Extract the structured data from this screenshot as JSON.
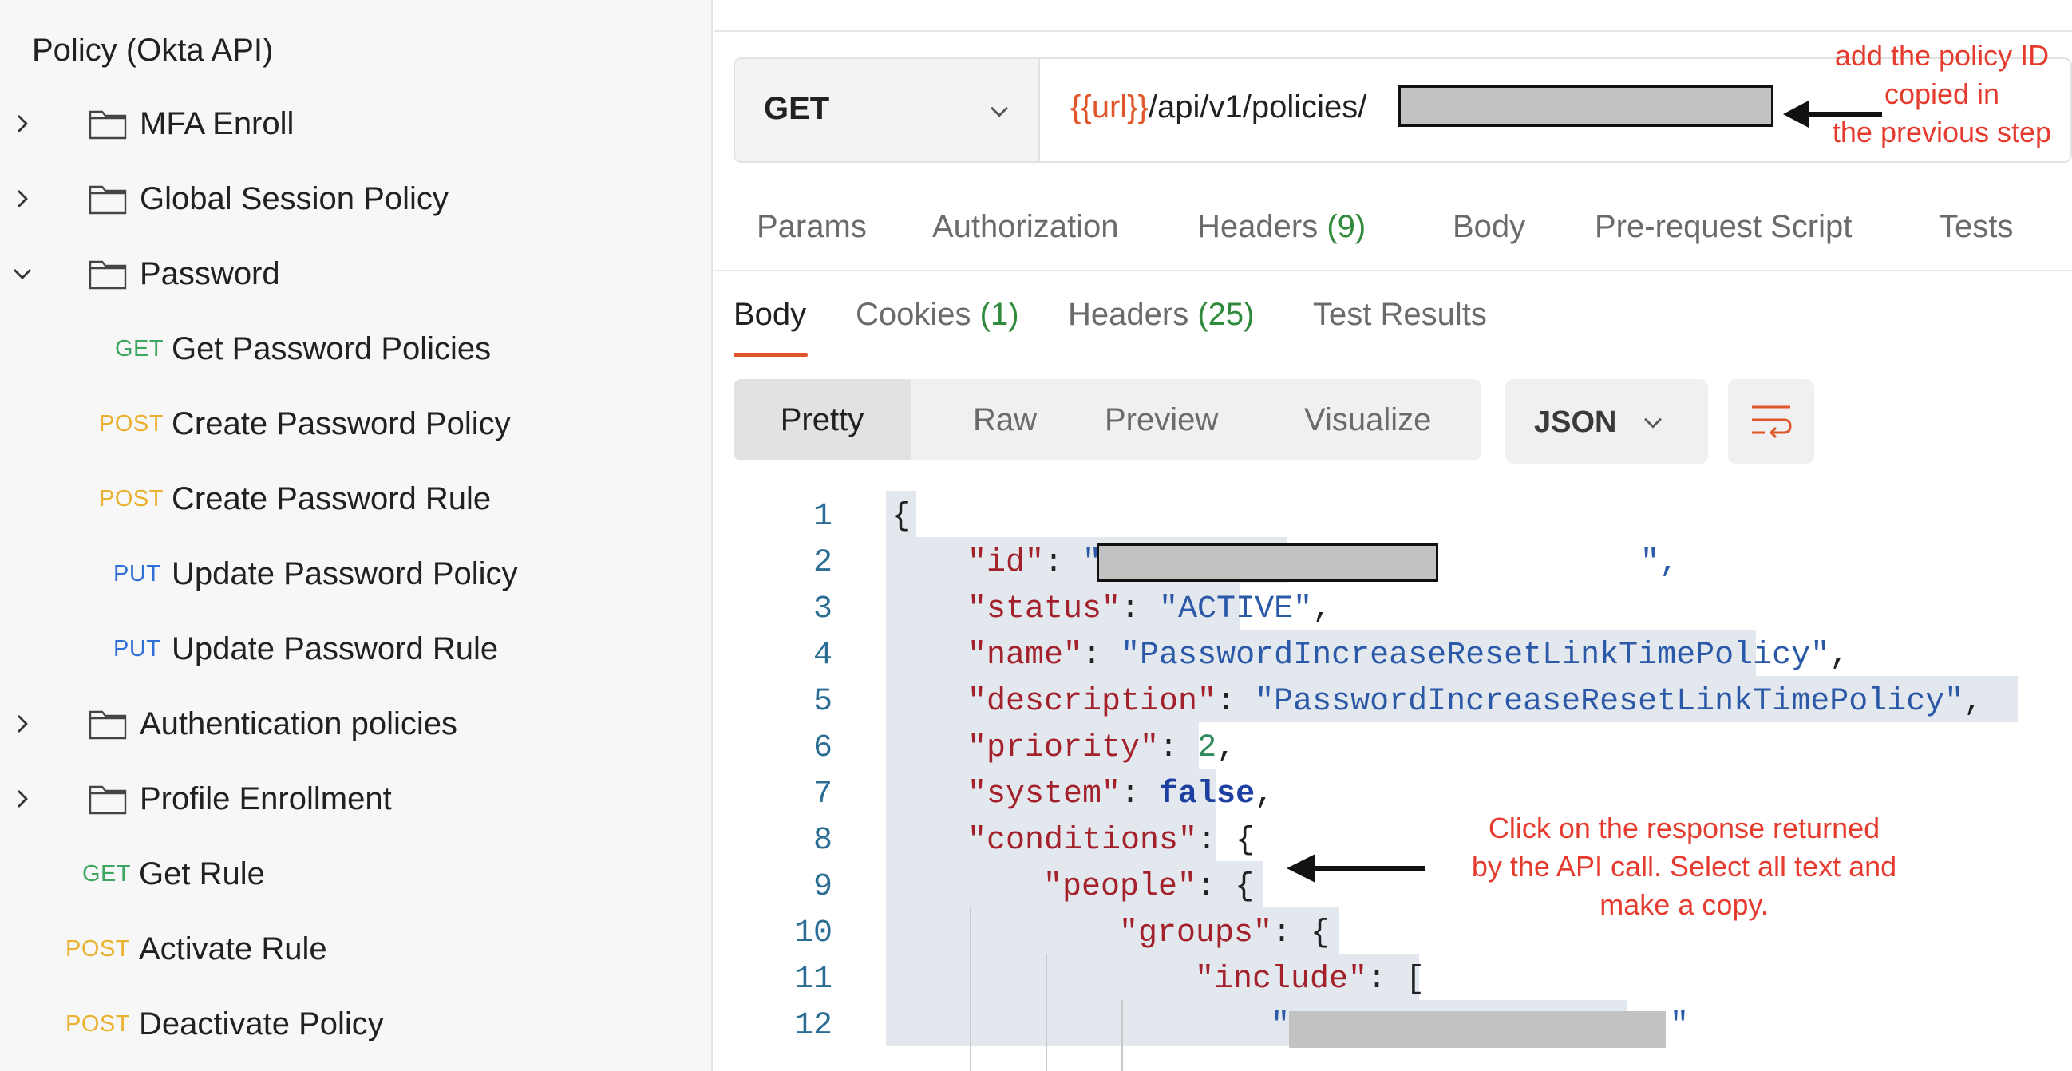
{
  "sidebar": {
    "collection_title": "Policy (Okta API)",
    "items": [
      {
        "label": "MFA Enroll",
        "type": "folder",
        "expanded": false
      },
      {
        "label": "Global Session Policy",
        "type": "folder",
        "expanded": false
      },
      {
        "label": "Password",
        "type": "folder",
        "expanded": true
      },
      {
        "method": "GET",
        "label": "Get Password Policies"
      },
      {
        "method": "POST",
        "label": "Create Password Policy"
      },
      {
        "method": "POST",
        "label": "Create Password Rule"
      },
      {
        "method": "PUT",
        "label": "Update Password Policy"
      },
      {
        "method": "PUT",
        "label": "Update Password Rule"
      },
      {
        "label": "Authentication policies",
        "type": "folder",
        "expanded": false
      },
      {
        "label": "Profile Enrollment",
        "type": "folder",
        "expanded": false
      },
      {
        "method": "GET",
        "label": "Get Rule"
      },
      {
        "method": "POST",
        "label": "Activate Rule"
      },
      {
        "method": "POST",
        "label": "Deactivate Policy"
      }
    ]
  },
  "request": {
    "method": "GET",
    "url_variable": "{{url}}",
    "url_path": "/api/v1/policies/"
  },
  "annotations": {
    "policy_id_note": [
      "add the policy ID",
      "copied in",
      "the previous step"
    ],
    "copy_note": [
      "Click on the response returned",
      "by the API call. Select all text and",
      "make a copy."
    ]
  },
  "request_tabs": [
    {
      "label": "Params"
    },
    {
      "label": "Authorization"
    },
    {
      "label": "Headers",
      "count": "(9)"
    },
    {
      "label": "Body"
    },
    {
      "label": "Pre-request Script"
    },
    {
      "label": "Tests"
    }
  ],
  "response_tabs": [
    {
      "label": "Body",
      "active": true
    },
    {
      "label": "Cookies",
      "count": "(1)"
    },
    {
      "label": "Headers",
      "count": "(25)"
    },
    {
      "label": "Test Results"
    }
  ],
  "view_modes": [
    "Pretty",
    "Raw",
    "Preview",
    "Visualize"
  ],
  "format": "JSON",
  "response_body": {
    "line_numbers": [
      "1",
      "2",
      "3",
      "4",
      "5",
      "6",
      "7",
      "8",
      "9",
      "10",
      "11",
      "12"
    ],
    "lines": [
      {
        "key": "",
        "sep": "",
        "value": "{"
      },
      {
        "key": "\"id\"",
        "sep": ": ",
        "value": "\"",
        "tail": "\","
      },
      {
        "key": "\"status\"",
        "sep": ": ",
        "value": "\"ACTIVE\"",
        "tail": ","
      },
      {
        "key": "\"name\"",
        "sep": ": ",
        "value": "\"PasswordIncreaseResetLinkTimePolicy\"",
        "tail": ","
      },
      {
        "key": "\"description\"",
        "sep": ": ",
        "value": "\"PasswordIncreaseResetLinkTimePolicy\"",
        "tail": ","
      },
      {
        "key": "\"priority\"",
        "sep": ": ",
        "value": "2",
        "tail": ","
      },
      {
        "key": "\"system\"",
        "sep": ": ",
        "value": "false",
        "tail": ","
      },
      {
        "key": "\"conditions\"",
        "sep": ": ",
        "value": "{"
      },
      {
        "key": "\"people\"",
        "sep": ": ",
        "value": "{"
      },
      {
        "key": "\"groups\"",
        "sep": ": ",
        "value": "{"
      },
      {
        "key": "\"include\"",
        "sep": ": ",
        "value": "["
      },
      {
        "key": "",
        "sep": "",
        "value": "\"",
        "tail": "\""
      }
    ]
  },
  "colors": {
    "accent": "#e0562a",
    "get": "#3da660",
    "post": "#e9b12f",
    "put": "#2f6fd7",
    "annotation": "#e53b2f"
  }
}
